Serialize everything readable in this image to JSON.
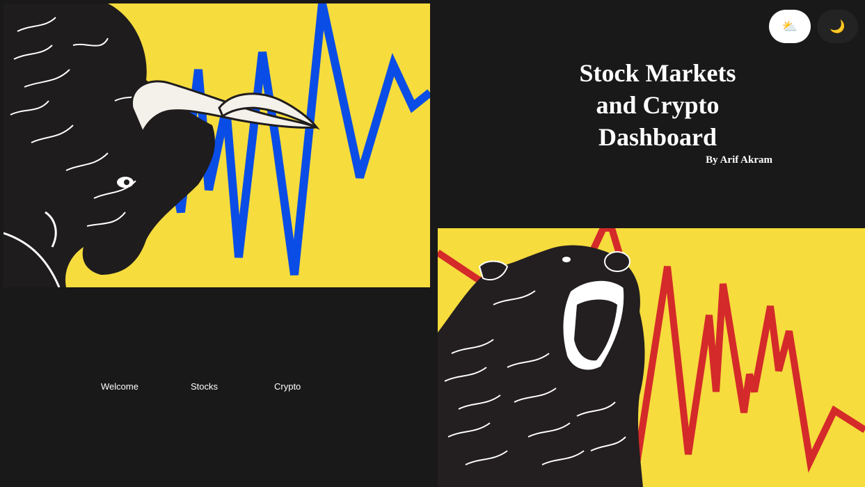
{
  "header": {
    "title_line1": "Stock Markets",
    "title_line2": "and Crypto",
    "title_line3": "Dashboard",
    "author": "By Arif Akram"
  },
  "theme_toggle": {
    "light_icon": "sun-behind-cloud-icon",
    "light_glyph": "⛅",
    "dark_icon": "crescent-moon-icon",
    "dark_glyph": "🌙"
  },
  "nav": {
    "items": [
      {
        "label": "Welcome"
      },
      {
        "label": "Stocks"
      },
      {
        "label": "Crypto"
      }
    ]
  },
  "images": {
    "bull": {
      "name": "bull-market-illustration",
      "background": "#f6dc3d",
      "line_color": "#0a4de6"
    },
    "bear": {
      "name": "bear-market-illustration",
      "background": "#f6dc3d",
      "line_color": "#d42a2a"
    }
  },
  "colors": {
    "page_background": "#191919",
    "text": "#ffffff",
    "toggle_light_bg": "#ffffff",
    "toggle_dark_bg": "#232323"
  }
}
